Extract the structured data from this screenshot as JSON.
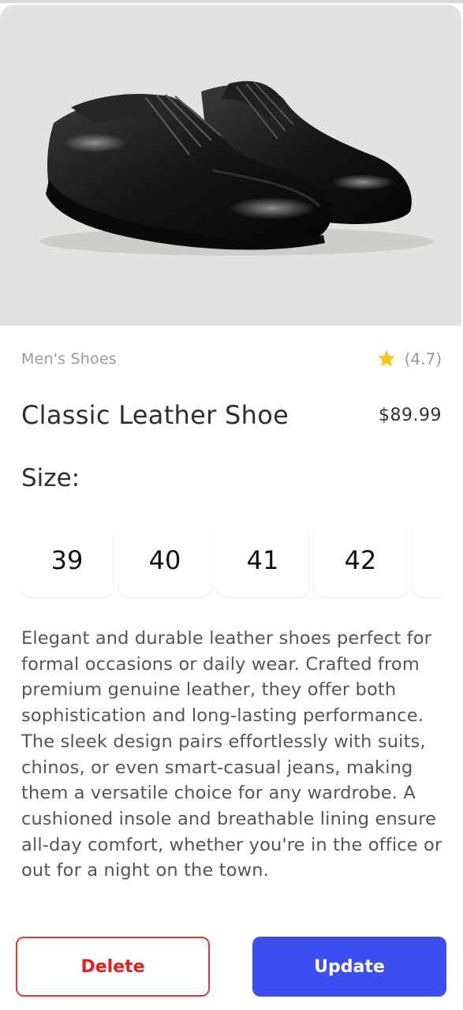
{
  "product": {
    "category": "Men's Shoes",
    "rating_text": "(4.7)",
    "title": "Classic Leather Shoe",
    "price": "$89.99",
    "size_label": "Size:",
    "sizes": [
      "39",
      "40",
      "41",
      "42"
    ],
    "description": "Elegant and durable leather shoes perfect for formal occasions or daily wear. Crafted from premium genuine leather, they offer both sophistication and long-lasting performance. The sleek design pairs effortlessly with suits, chinos, or even smart-casual jeans, making them a versatile choice for any wardrobe. A cushioned insole and breathable lining ensure all-day comfort, whether you're in the office or out for a night on the town."
  },
  "actions": {
    "delete_label": "Delete",
    "update_label": "Update"
  },
  "icons": {
    "rating": "star-icon"
  },
  "colors": {
    "star": "#f5c518",
    "delete": "#e02020",
    "update_bg": "#3d4ef0",
    "hero_bg": "#e3e2e0"
  }
}
